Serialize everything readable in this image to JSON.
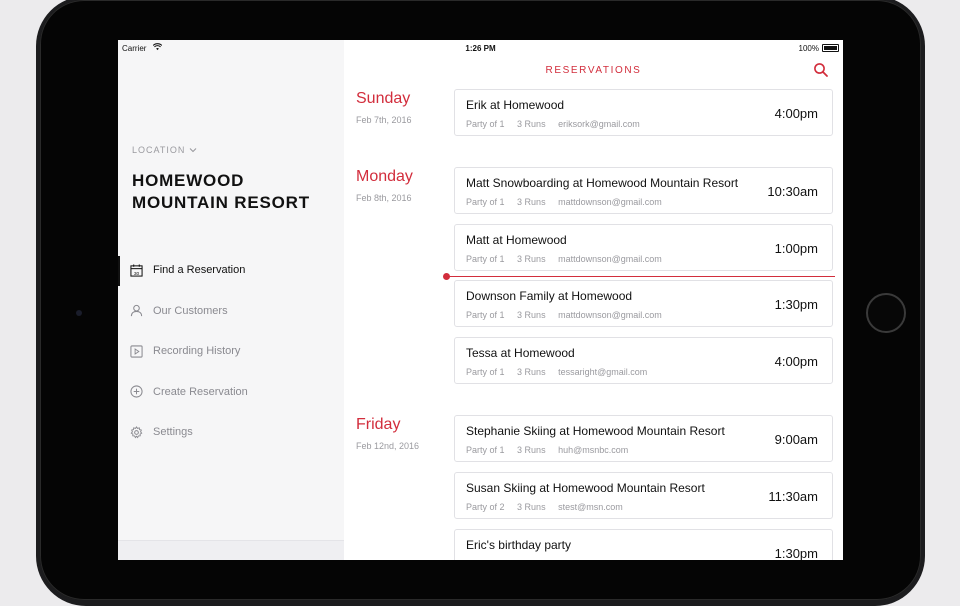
{
  "status": {
    "carrier": "Carrier",
    "time": "1:26 PM",
    "battery": "100%"
  },
  "sidebar": {
    "location_label": "LOCATION",
    "resort_name": "HOMEWOOD MOUNTAIN RESORT",
    "items": [
      {
        "label": "Find a Reservation",
        "icon": "calendar-icon"
      },
      {
        "label": "Our Customers",
        "icon": "person-icon"
      },
      {
        "label": "Recording History",
        "icon": "play-icon"
      },
      {
        "label": "Create Reservation",
        "icon": "plus-circle-icon"
      },
      {
        "label": "Settings",
        "icon": "gear-icon"
      }
    ],
    "calendar_day": "30"
  },
  "main": {
    "title": "RESERVATIONS",
    "days": [
      {
        "day": "Sunday",
        "date": "Feb 7th, 2016",
        "reservations": [
          {
            "title": "Erik at Homewood",
            "party": "Party of 1",
            "runs": "3 Runs",
            "email": "eriksork@gmail.com",
            "time": "4:00pm"
          }
        ]
      },
      {
        "day": "Monday",
        "date": "Feb 8th, 2016",
        "reservations": [
          {
            "title": "Matt Snowboarding at Homewood Mountain Resort",
            "party": "Party of 1",
            "runs": "3 Runs",
            "email": "mattdownson@gmail.com",
            "time": "10:30am"
          },
          {
            "title": "Matt at Homewood",
            "party": "Party of 1",
            "runs": "3 Runs",
            "email": "mattdownson@gmail.com",
            "time": "1:00pm"
          },
          {
            "title": "Downson Family at Homewood",
            "party": "Party of 1",
            "runs": "3 Runs",
            "email": "mattdownson@gmail.com",
            "time": "1:30pm"
          },
          {
            "title": "Tessa at Homewood",
            "party": "Party of 1",
            "runs": "3 Runs",
            "email": "tessaright@gmail.com",
            "time": "4:00pm"
          }
        ]
      },
      {
        "day": "Friday",
        "date": "Feb 12nd, 2016",
        "reservations": [
          {
            "title": "Stephanie Skiing at Homewood Mountain Resort",
            "party": "Party of 1",
            "runs": "3 Runs",
            "email": "huh@msnbc.com",
            "time": "9:00am"
          },
          {
            "title": "Susan Skiing at Homewood Mountain Resort",
            "party": "Party of 2",
            "runs": "3 Runs",
            "email": "stest@msn.com",
            "time": "11:30am"
          },
          {
            "title": "Eric's birthday party",
            "party": "",
            "runs": "",
            "email": "",
            "time": "1:30pm"
          }
        ]
      }
    ]
  },
  "colors": {
    "accent": "#d22d3c",
    "text": "#111111",
    "muted": "#9a9a9f",
    "sidebar_bg": "#f6f6f7"
  }
}
